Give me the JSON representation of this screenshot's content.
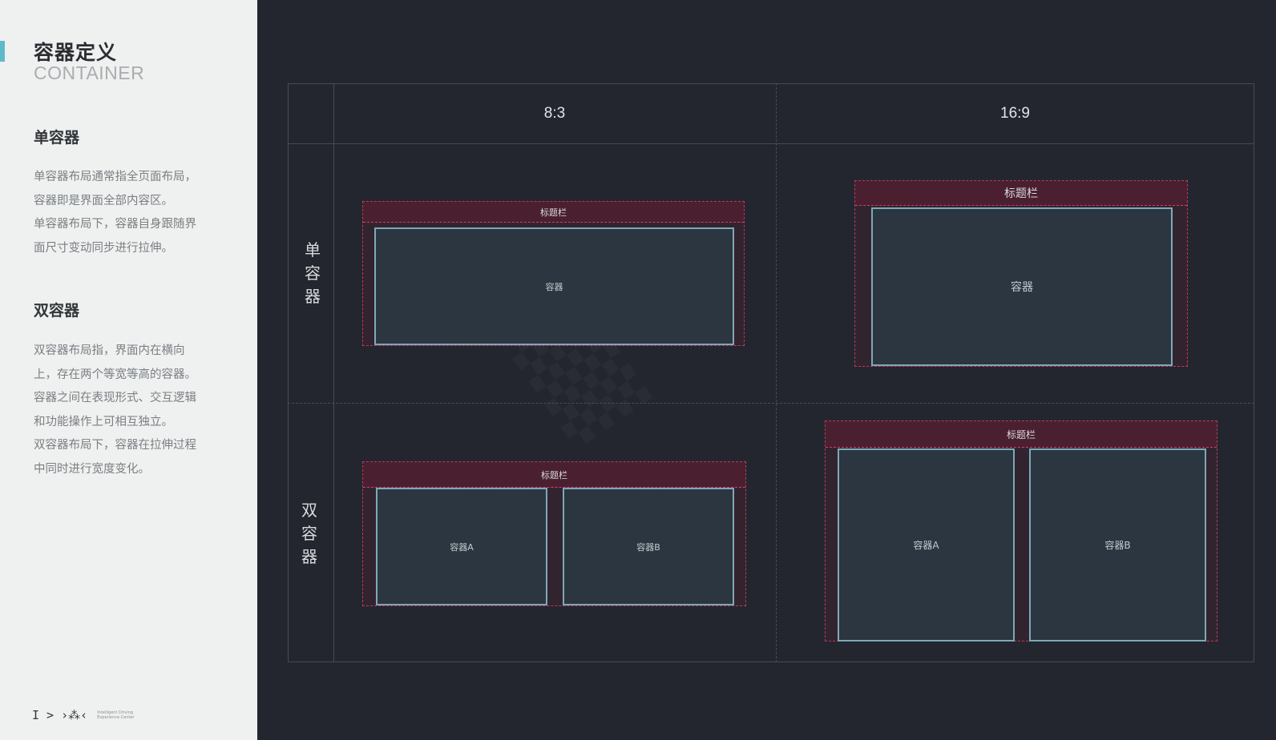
{
  "sidebar": {
    "title_zh": "容器定义",
    "title_en": "CONTAINER",
    "single": {
      "heading": "单容器",
      "lines": [
        "单容器布局通常指全页面布局，",
        "容器即是界面全部内容区。",
        "单容器布局下，容器自身跟随界",
        "面尺寸变动同步进行拉伸。"
      ]
    },
    "double": {
      "heading": "双容器",
      "lines": [
        "双容器布局指，界面内在横向",
        "上，存在两个等宽等高的容器。",
        "容器之间在表现形式、交互逻辑",
        "和功能操作上可相互独立。",
        "双容器布局下，容器在拉伸过程",
        "中同时进行宽度变化。"
      ]
    },
    "logo": {
      "glyphs": "I > ›⁂‹",
      "line1": "Intelligent Driving",
      "line2": "Experience Center"
    }
  },
  "grid": {
    "columns": [
      "8:3",
      "16:9"
    ],
    "rows": [
      [
        "单",
        "容",
        "器"
      ],
      [
        "双",
        "容",
        "器"
      ]
    ]
  },
  "diagrams": {
    "titlebar_label": "标题栏",
    "container_label": "容器",
    "container_a_label": "容器A",
    "container_b_label": "容器B"
  },
  "colors": {
    "background": "#23262e",
    "sidebar": "#eef1ef",
    "accent": "#5fb9c8",
    "guide_dash": "#b93a5b",
    "container_border": "#7fa8b6",
    "container_fill": "#2b3641"
  }
}
